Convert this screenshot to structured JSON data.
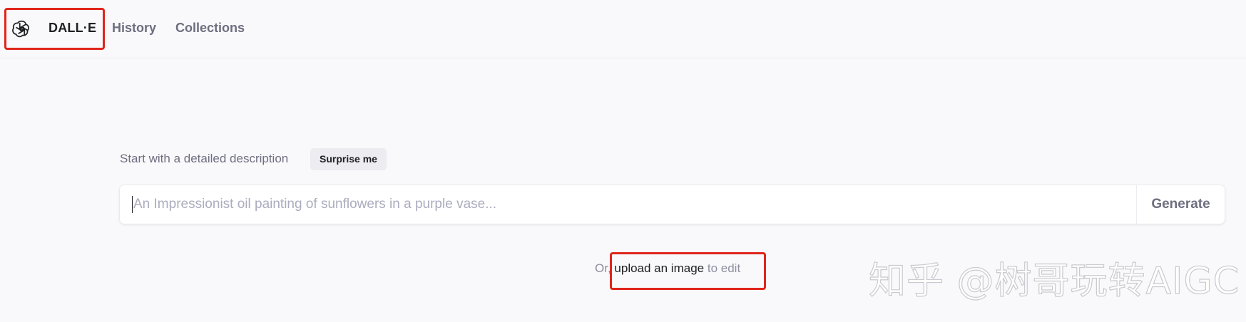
{
  "header": {
    "brand": "DALL·E",
    "nav": [
      "History",
      "Collections"
    ]
  },
  "prompt": {
    "label": "Start with a detailed description",
    "surprise_label": "Surprise me",
    "placeholder": "An Impressionist oil painting of sunflowers in a purple vase...",
    "value": "",
    "generate_label": "Generate"
  },
  "upload": {
    "prefix": "Or,",
    "link_text": "upload an image",
    "suffix": "to edit"
  },
  "watermark": {
    "text": "知乎 @树哥玩转AIGC"
  },
  "colors": {
    "background": "#f9f9fb",
    "highlight": "#e0251b",
    "muted_text": "#6e6e80"
  },
  "icons": [
    "openai-logo-icon"
  ]
}
